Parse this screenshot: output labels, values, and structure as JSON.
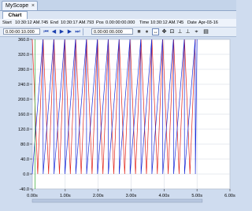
{
  "window": {
    "tab_title": "MyScope",
    "close_glyph": "×"
  },
  "subtab": {
    "label": "Chart"
  },
  "info": {
    "start_label": "Start",
    "start_value": "10:30:12 AM.745",
    "end_label": "End",
    "end_value": "10:30:17 AM.793",
    "pos_label": "Pos",
    "pos_value": "0.00:00:00.000",
    "time_label": "Time",
    "time_value": "10:30:12 AM.745",
    "date_label": "Date",
    "date_value": "Apr-03-16"
  },
  "toolbar": {
    "range_input": "0.00:00:10.000",
    "position_input": "0.00:00:00.000",
    "icons": [
      "first-icon",
      "prev-icon",
      "play-icon",
      "next-icon",
      "last-icon",
      "stop-icon",
      "record-icon",
      "zoom-x-icon",
      "pan-icon",
      "zoom-xy-icon",
      "axis-icon",
      "axis2-icon",
      "cursor-icon",
      "save-icon"
    ]
  },
  "colors": {
    "series_red": "#e2231a",
    "series_blue": "#1a2ad8",
    "series_green": "#2fa82f",
    "plot_bg": "#ffffff",
    "grid": "#cfd6e0"
  },
  "chart_data": {
    "type": "line",
    "yticks": [
      "360.0",
      "320.0",
      "280.0",
      "240.0",
      "200.0",
      "160.0",
      "120.0",
      "80.0",
      "40.0",
      "0.0",
      "-40.0"
    ],
    "xticks": [
      "0.00s",
      "1.00s",
      "2.00s",
      "3.00s",
      "4.00s",
      "5.00s",
      "6.00s"
    ],
    "ylim": [
      -40,
      360
    ],
    "xlim": [
      0,
      6
    ],
    "series": [
      {
        "color": "red",
        "shape": "triangle",
        "period_s": 0.33,
        "min": 0,
        "max": 360,
        "end_s": 5.0
      },
      {
        "color": "blue",
        "shape": "sawtooth",
        "period_s": 0.33,
        "min": 0,
        "max": 360,
        "end_s": 5.0
      }
    ]
  }
}
